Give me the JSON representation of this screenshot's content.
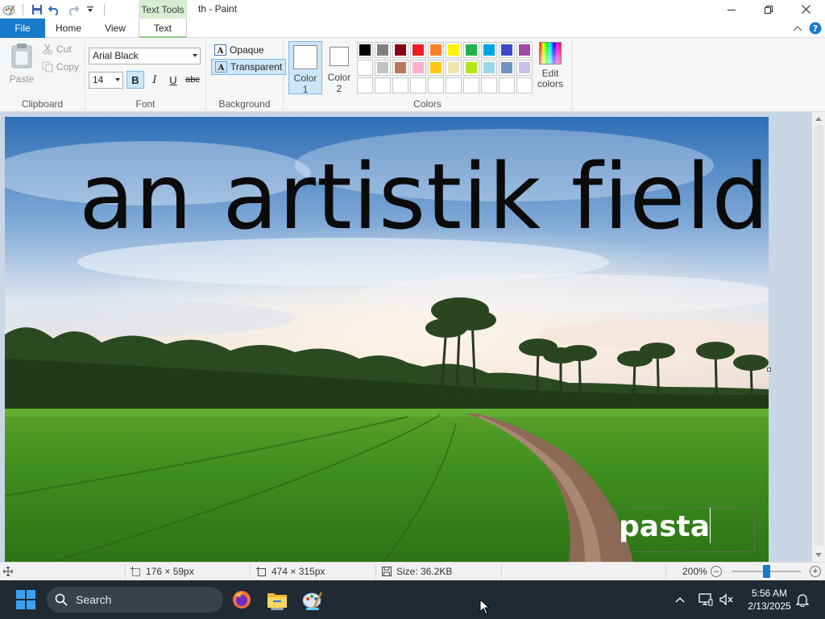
{
  "window": {
    "title": "th - Paint",
    "contextual_tab_header": "Text Tools"
  },
  "tabs": [
    {
      "label": "File",
      "active": false
    },
    {
      "label": "Home",
      "active": false
    },
    {
      "label": "View",
      "active": false
    },
    {
      "label": "Text",
      "active": true
    }
  ],
  "ribbon": {
    "clipboard": {
      "group_label": "Clipboard",
      "paste_label": "Paste",
      "cut_label": "Cut",
      "copy_label": "Copy"
    },
    "font": {
      "group_label": "Font",
      "font_family_value": "Arial Black",
      "font_size_value": "14",
      "bold_label": "B",
      "italic_label": "I",
      "underline_label": "U",
      "strikethrough_label": "abc",
      "bold_active": true
    },
    "background": {
      "group_label": "Background",
      "opaque_label": "Opaque",
      "transparent_label": "Transparent",
      "selected": "transparent"
    },
    "colors": {
      "group_label": "Colors",
      "color1_label_line1": "Color",
      "color1_label_line2": "1",
      "color2_label_line1": "Color",
      "color2_label_line2": "2",
      "color1_value": "#ffffff",
      "color2_value": "#ffffff",
      "edit_colors_line1": "Edit",
      "edit_colors_line2": "colors",
      "palette": [
        "#000000",
        "#7f7f7f",
        "#880015",
        "#ed1c24",
        "#ff7f27",
        "#fff200",
        "#22b14c",
        "#00a2e8",
        "#3f48cc",
        "#a349a4",
        "#ffffff",
        "#c3c3c3",
        "#b97a57",
        "#ffaec9",
        "#ffc90e",
        "#efe4b0",
        "#b5e61d",
        "#99d9ea",
        "#7092be",
        "#c8bfe7",
        "",
        "",
        "",
        "",
        "",
        "",
        "",
        "",
        "",
        ""
      ]
    }
  },
  "canvas": {
    "headline_text": "an artistik field",
    "textbox_text": "pasta"
  },
  "status": {
    "selection_size": "176 × 59px",
    "image_size": "474 × 315px",
    "file_size": "Size: 36.2KB",
    "zoom": "200%",
    "zoom_level_fraction": 0.5
  },
  "taskbar": {
    "search_placeholder": "Search",
    "time": "5:56 AM",
    "date": "2/13/2025"
  },
  "accent_color": "#1979ca"
}
